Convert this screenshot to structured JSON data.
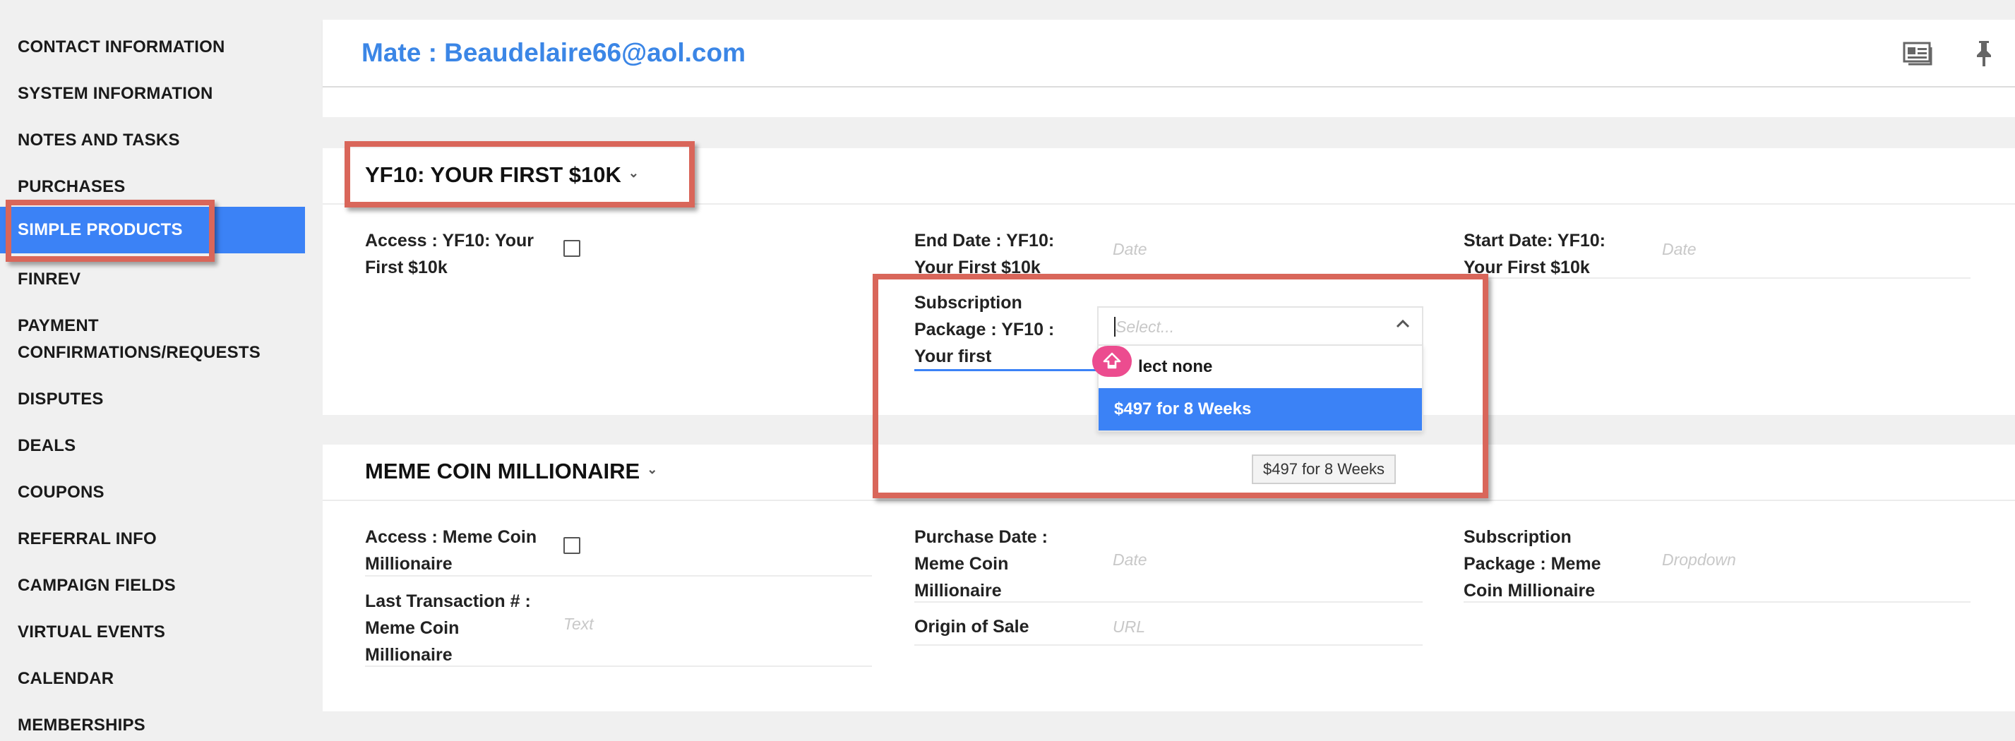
{
  "sidebar": {
    "items": [
      {
        "label": "CONTACT INFORMATION"
      },
      {
        "label": "SYSTEM INFORMATION"
      },
      {
        "label": "NOTES AND TASKS"
      },
      {
        "label": "PURCHASES"
      },
      {
        "label": "SIMPLE PRODUCTS",
        "active": true
      },
      {
        "label": "FINREV"
      },
      {
        "label": "PAYMENT",
        "label2": "CONFIRMATIONS/REQUESTS"
      },
      {
        "label": "DISPUTES"
      },
      {
        "label": "DEALS"
      },
      {
        "label": "COUPONS"
      },
      {
        "label": "REFERRAL INFO"
      },
      {
        "label": "CAMPAIGN FIELDS"
      },
      {
        "label": "VIRTUAL EVENTS"
      },
      {
        "label": "CALENDAR"
      },
      {
        "label": "MEMBERSHIPS"
      }
    ]
  },
  "header": {
    "title": "Mate : Beaudelaire66@aol.com",
    "icons": [
      "contact-card-icon",
      "pin-icon"
    ]
  },
  "section1": {
    "title": "YF10: YOUR FIRST $10K",
    "fields": {
      "access": {
        "line1": "Access : YF10: Your",
        "line2": "First $10k"
      },
      "end_date": {
        "line1": "End Date : YF10:",
        "line2": "Your First $10k",
        "placeholder": "Date"
      },
      "start_date": {
        "line1": "Start Date: YF10:",
        "line2": "Your First $10k",
        "placeholder": "Date"
      },
      "subscription": {
        "line1": "Subscription",
        "line2": "Package : YF10 :",
        "line3": "Your first"
      }
    },
    "dropdown": {
      "placeholder": "Select...",
      "options": [
        "lect none",
        "$497 for 8 Weeks"
      ],
      "selected": "$497 for 8 Weeks",
      "tooltip": "$497 for 8 Weeks"
    }
  },
  "section2": {
    "title": "MEME COIN MILLIONAIRE",
    "fields": {
      "access": {
        "line1": "Access : Meme Coin",
        "line2": "Millionaire"
      },
      "purchase_date": {
        "line1": "Purchase Date :",
        "line2": "Meme Coin",
        "line3": "Millionaire",
        "placeholder": "Date"
      },
      "subscription": {
        "line1": "Subscription",
        "line2": "Package : Meme",
        "line3": "Coin Millionaire",
        "placeholder": "Dropdown"
      },
      "last_transaction": {
        "line1": "Last Transaction # :",
        "line2": "Meme Coin",
        "line3": "Millionaire",
        "placeholder": "Text"
      },
      "origin_of_sale": {
        "line1": "Origin of Sale",
        "placeholder": "URL"
      }
    }
  },
  "colors": {
    "accent": "#3b82f6",
    "title_blue": "#3b86e6",
    "annotation_red": "#d9665a",
    "badge_pink": "#ec4c8f"
  }
}
